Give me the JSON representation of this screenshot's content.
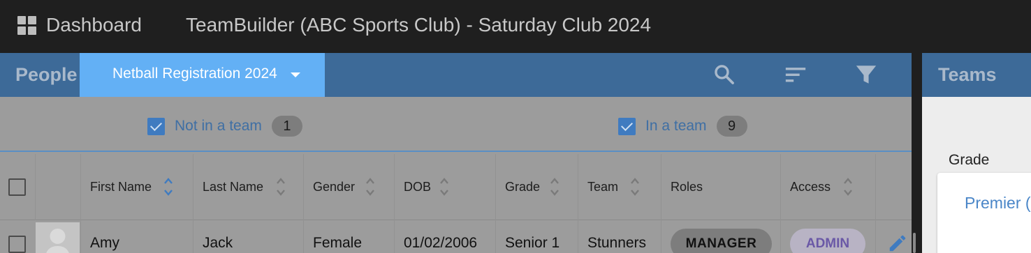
{
  "topbar": {
    "dashboard_label": "Dashboard",
    "app_title": "TeamBuilder (ABC Sports Club) - Saturday Club 2024"
  },
  "people": {
    "title": "People",
    "registration_select": "Netball Registration 2024",
    "header_icons": [
      "search-icon",
      "sort-icon",
      "filter-icon"
    ],
    "filters": [
      {
        "label": "Not in a team",
        "count": "1",
        "checked": true
      },
      {
        "label": "In a team",
        "count": "9",
        "checked": true
      }
    ],
    "columns": [
      {
        "label": "First Name",
        "sortable": true,
        "active": true
      },
      {
        "label": "Last Name",
        "sortable": true
      },
      {
        "label": "Gender",
        "sortable": true
      },
      {
        "label": "DOB",
        "sortable": true
      },
      {
        "label": "Grade",
        "sortable": true
      },
      {
        "label": "Team",
        "sortable": true
      },
      {
        "label": "Roles",
        "sortable": false
      },
      {
        "label": "Access",
        "sortable": true
      }
    ],
    "rows": [
      {
        "first_name": "Amy",
        "last_name": "Jack",
        "gender": "Female",
        "dob": "01/02/2006",
        "grade": "Senior 1",
        "team": "Stunners",
        "role": "MANAGER",
        "access": "ADMIN"
      }
    ]
  },
  "teams": {
    "title": "Teams",
    "grade_label": "Grade",
    "premier_label": "Premier ("
  },
  "colors": {
    "header_blue": "#3d6a98",
    "select_blue": "#63b0f5",
    "checkbox_blue": "#3f7bc0",
    "admin_purple": "#6a58a6"
  }
}
